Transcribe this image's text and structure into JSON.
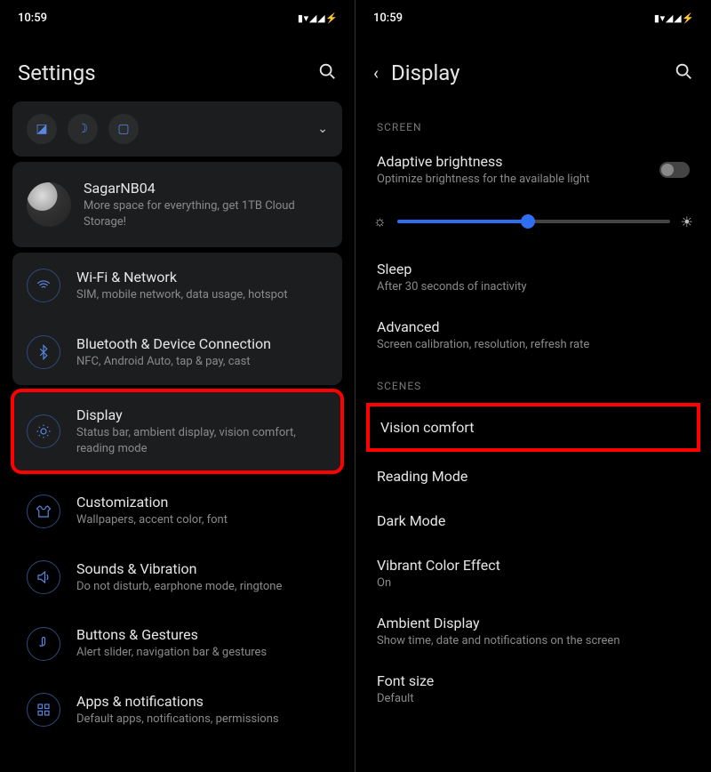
{
  "status": {
    "time": "10:59"
  },
  "left": {
    "header_title": "Settings",
    "account": {
      "name": "SagarNB04",
      "sub": "More space for everything, get 1TB Cloud Storage!"
    },
    "wifi": {
      "title": "Wi-Fi & Network",
      "sub": "SIM, mobile network, data usage, hotspot"
    },
    "bt": {
      "title": "Bluetooth & Device Connection",
      "sub": "NFC, Android Auto, tap & pay, cast"
    },
    "display": {
      "title": "Display",
      "sub": "Status bar, ambient display, vision comfort, reading mode"
    },
    "custom": {
      "title": "Customization",
      "sub": "Wallpapers, accent color, font"
    },
    "sound": {
      "title": "Sounds & Vibration",
      "sub": "Do not disturb, earphone mode, ringtone"
    },
    "buttons": {
      "title": "Buttons & Gestures",
      "sub": "Alert slider, navigation bar & gestures"
    },
    "apps": {
      "title": "Apps & notifications",
      "sub": "Default apps, notifications, permissions"
    }
  },
  "right": {
    "header_title": "Display",
    "section_screen": "SCREEN",
    "adaptive": {
      "title": "Adaptive brightness",
      "sub": "Optimize brightness for the available light"
    },
    "sleep": {
      "title": "Sleep",
      "sub": "After 30 seconds of inactivity"
    },
    "advanced": {
      "title": "Advanced",
      "sub": "Screen calibration, resolution, refresh rate"
    },
    "section_scenes": "SCENES",
    "vision": "Vision comfort",
    "reading": "Reading Mode",
    "dark": "Dark Mode",
    "vibrant": {
      "title": "Vibrant Color Effect",
      "sub": "On"
    },
    "ambient": {
      "title": "Ambient Display",
      "sub": "Show time, date and notifications on the screen"
    },
    "font": {
      "title": "Font size",
      "sub": "Default"
    }
  }
}
